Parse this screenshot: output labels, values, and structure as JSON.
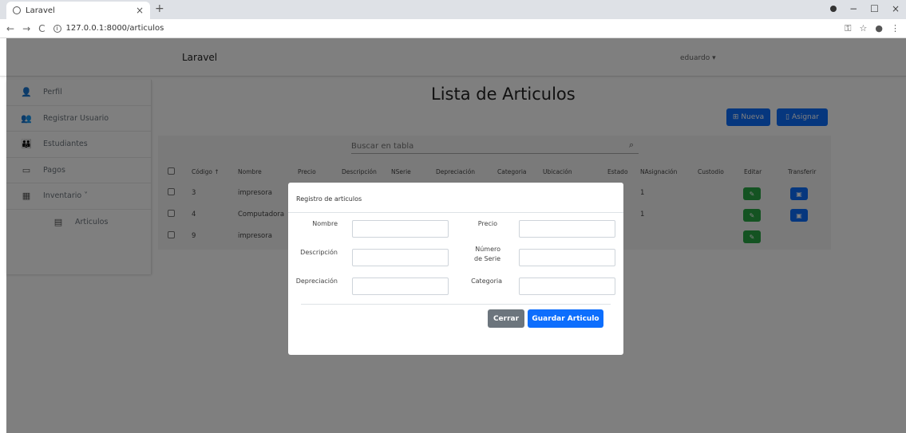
{
  "browser": {
    "tab_title": "Laravel",
    "tab_close": "×",
    "new_tab": "+",
    "url": "127.0.0.1:8000/articulos",
    "back": "←",
    "forward": "→",
    "reload": "C",
    "win_min": "−",
    "win_max": "☐",
    "win_close": "×"
  },
  "navbar": {
    "brand": "Laravel",
    "user": "eduardo ▾"
  },
  "sidebar": {
    "items": [
      {
        "label": "Perfil",
        "icon": "👤"
      },
      {
        "label": "Registrar Usuario",
        "icon": "👥"
      },
      {
        "label": "Estudiantes",
        "icon": "👪"
      },
      {
        "label": "Pagos",
        "icon": "▭"
      },
      {
        "label": "Inventario ˅",
        "icon": "▦"
      },
      {
        "label": "Articulos",
        "icon": "▤"
      }
    ]
  },
  "main": {
    "title": "Lista de Articulos",
    "new_label": "Nueva",
    "assign_label": "Asignar",
    "search_placeholder": "Buscar en tabla",
    "columns": [
      "Código ↑",
      "Nombre",
      "Precio",
      "Descripción",
      "NSerie",
      "Depreciación",
      "Categoria",
      "Ubicación",
      "Estado",
      "NAsignación",
      "Custodio",
      "Editar",
      "Transferir"
    ],
    "rows": [
      {
        "codigo": "3",
        "nombre": "impresora",
        "nasignacion": "1"
      },
      {
        "codigo": "4",
        "nombre": "Computadora",
        "nasignacion": "1"
      },
      {
        "codigo": "9",
        "nombre": "impresora",
        "nasignacion": ""
      }
    ],
    "edit_icon": "✎",
    "transfer_icon": "▣"
  },
  "modal": {
    "title": "Registro de articulos",
    "fields": {
      "nombre": "Nombre",
      "precio": "Precio",
      "descripcion": "Descripción",
      "numero_serie": "Número de Serie",
      "depreciacion": "Depreciación",
      "categoria": "Categoria"
    },
    "close_label": "Cerrar",
    "save_label": "Guardar Articulo"
  },
  "colors": {
    "primary": "#0d6efd",
    "success": "#28a745",
    "secondary": "#6c757d"
  }
}
